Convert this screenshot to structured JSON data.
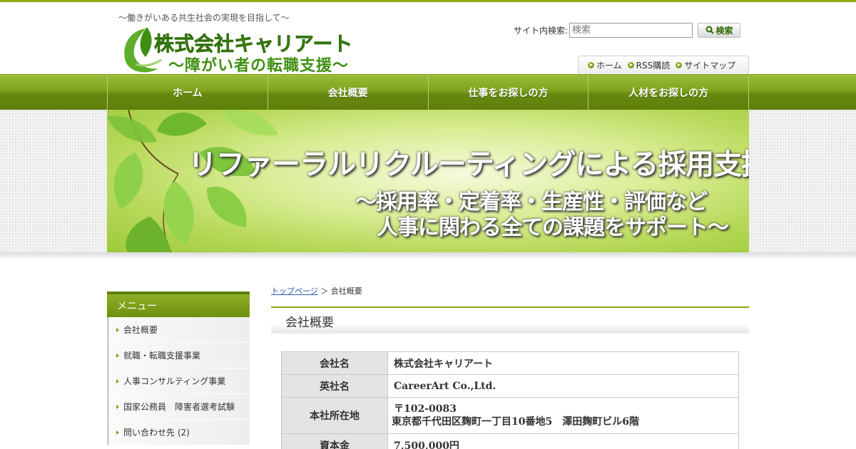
{
  "header": {
    "tagline": "～働きがいある共生社会の実現を目指して～",
    "logo_line1": "株式会社キャリアート",
    "logo_line2": "～障がい者の転職支援～"
  },
  "search": {
    "label": "サイト内検索:",
    "placeholder": "検索",
    "button_label": "検索"
  },
  "util_nav": {
    "items": [
      {
        "label": "ホーム"
      },
      {
        "label": "RSS購読"
      },
      {
        "label": "サイトマップ"
      }
    ]
  },
  "main_nav": {
    "items": [
      {
        "label": "ホーム"
      },
      {
        "label": "会社概要"
      },
      {
        "label": "仕事をお探しの方"
      },
      {
        "label": "人材をお探しの方"
      }
    ]
  },
  "hero": {
    "title": "リファーラルリクルーティングによる採用支援",
    "sub1": "～採用率・定着率・生産性・評価など",
    "sub2": "人事に関わる全ての課題をサポート～"
  },
  "sidebar": {
    "heading": "メニュー",
    "items": [
      {
        "label": "会社概要"
      },
      {
        "label": "就職・転職支援事業"
      },
      {
        "label": "人事コンサルティング事業"
      },
      {
        "label": "国家公務員　障害者選考試験"
      },
      {
        "label": "問い合わせ先 (2)"
      }
    ]
  },
  "breadcrumb": {
    "home": "トップページ",
    "sep": "＞",
    "current": "会社概要"
  },
  "page_title": "会社概要",
  "company_table": {
    "rows": [
      {
        "label": "会社名",
        "value": "株式会社キャリアート"
      },
      {
        "label": "英社名",
        "value": "CareerArt Co.,Ltd."
      },
      {
        "label": "本社所在地",
        "value_line1": "〒102-0083",
        "value_line2": "東京都千代田区麹町一丁目10番地5　澤田麹町ビル6階"
      },
      {
        "label": "資本金",
        "value": "7,500,000円"
      }
    ]
  },
  "colors": {
    "accent": "#8aab10",
    "nav_green": "#7ea31d",
    "logo_green": "#3f8f12"
  }
}
